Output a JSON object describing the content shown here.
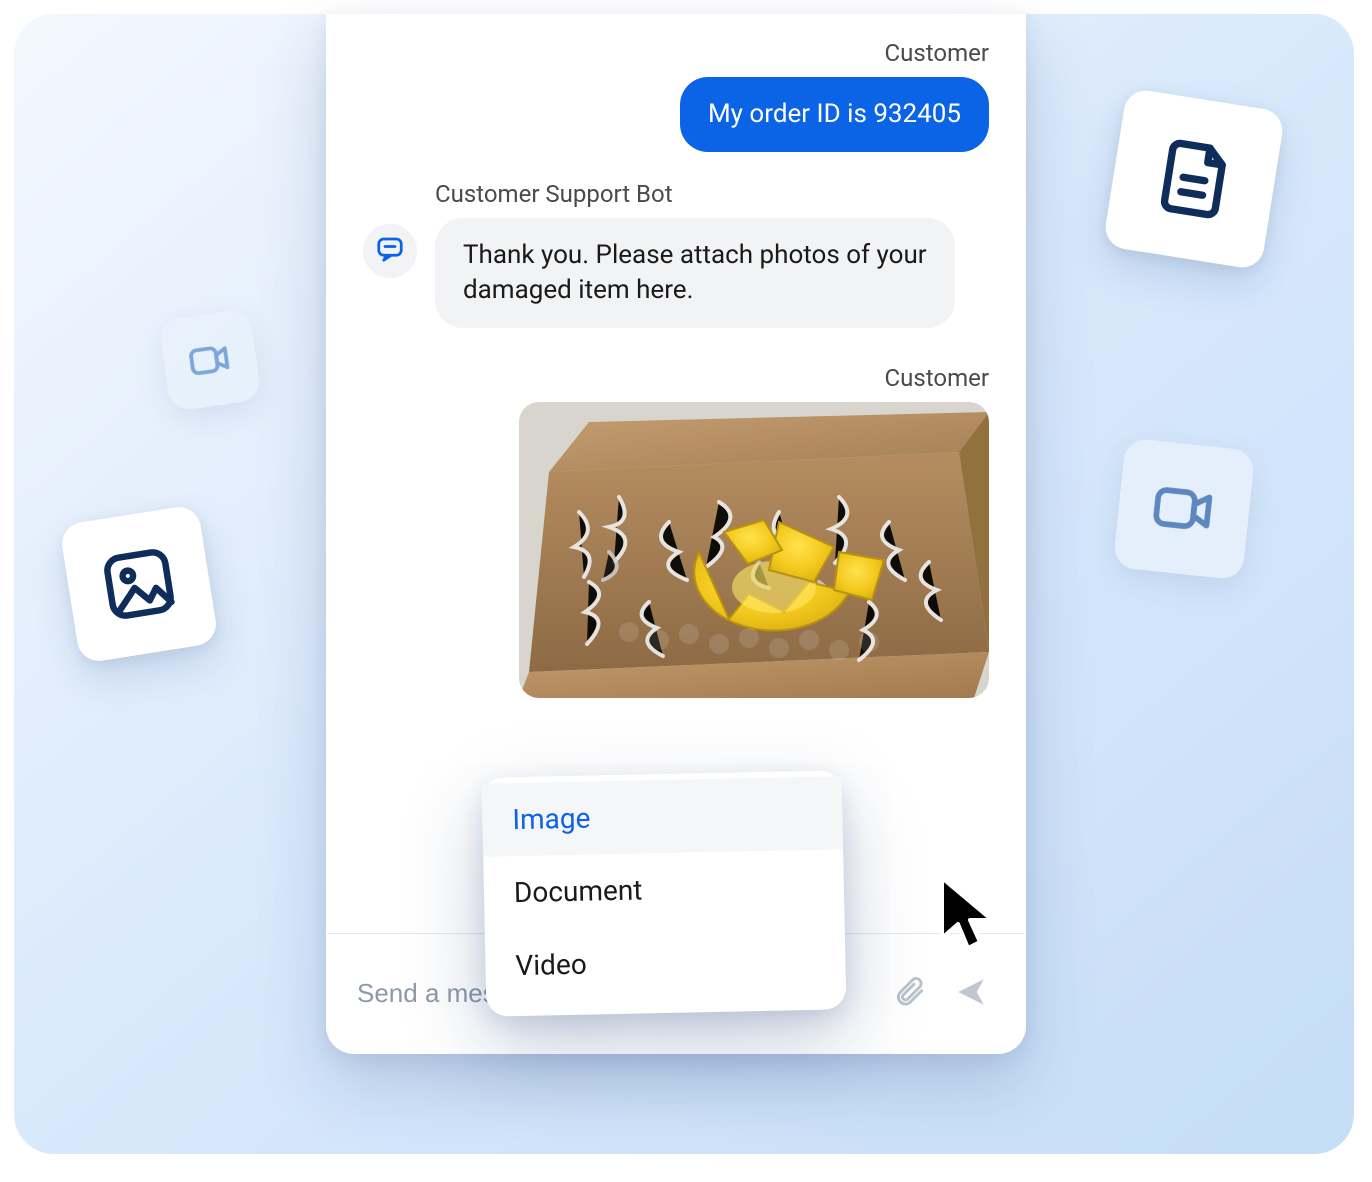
{
  "chat": {
    "messages": {
      "m0": {
        "sender": "Customer",
        "text": "My order ID is 932405"
      },
      "m1": {
        "sender": "Customer Support Bot",
        "text": "Thank you. Please attach photos of your damaged item here."
      },
      "m2": {
        "sender": "Customer"
      }
    },
    "composer": {
      "placeholder": "Send a message"
    }
  },
  "attach_menu": {
    "items": {
      "image": {
        "label": "Image"
      },
      "document": {
        "label": "Document"
      },
      "video": {
        "label": "Video"
      }
    }
  },
  "attachment": {
    "alt": "damaged-item-photo"
  },
  "colors": {
    "accent": "#0b63e5",
    "navy": "#0f2d5b"
  }
}
